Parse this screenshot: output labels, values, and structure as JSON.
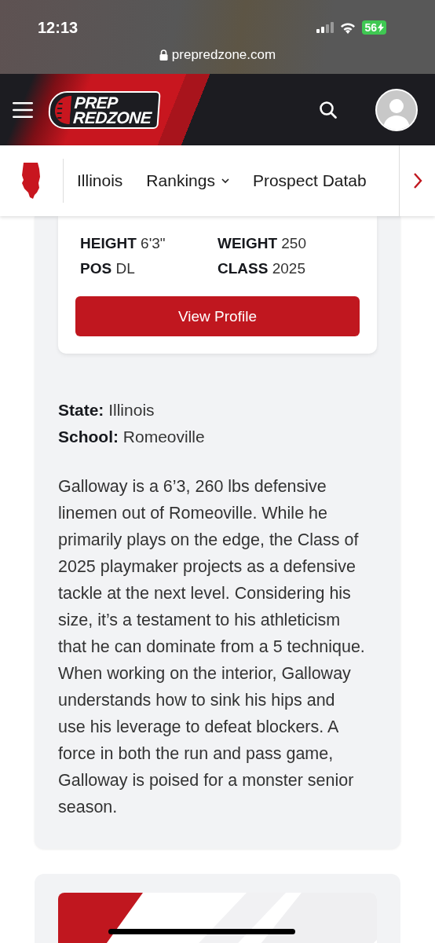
{
  "status_bar": {
    "time": "12:13",
    "battery": "56",
    "charging": true,
    "url": "prepredzone.com"
  },
  "header": {
    "logo": [
      "PREP",
      "REDZONE"
    ]
  },
  "subnav": {
    "items": [
      {
        "label": "Illinois",
        "kind": "link"
      },
      {
        "label": "Rankings",
        "kind": "dropdown"
      },
      {
        "label": "Prospect Datab",
        "kind": "link"
      }
    ]
  },
  "player_card": {
    "stats": [
      {
        "label": "HEIGHT",
        "value": "6'3\""
      },
      {
        "label": "WEIGHT",
        "value": "250"
      },
      {
        "label": "POS",
        "value": "DL"
      },
      {
        "label": "CLASS",
        "value": "2025"
      }
    ],
    "button": "View Profile"
  },
  "details": [
    {
      "label": "State:",
      "value": "Illinois"
    },
    {
      "label": "School:",
      "value": "Romeoville"
    }
  ],
  "bio": "Galloway is a 6’3, 260 lbs defensive linemen out of Romeoville. While he primarily plays on the edge, the Class of 2025 playmaker projects as a defensive tackle at the next level. Considering his size, it’s a testament to his athleticism that he can dominate from a 5 technique. When working on the interior, Galloway understands how to sink his hips and use his leverage to defeat blockers. A force in both the run and pass game, Galloway is poised for a monster senior season."
}
